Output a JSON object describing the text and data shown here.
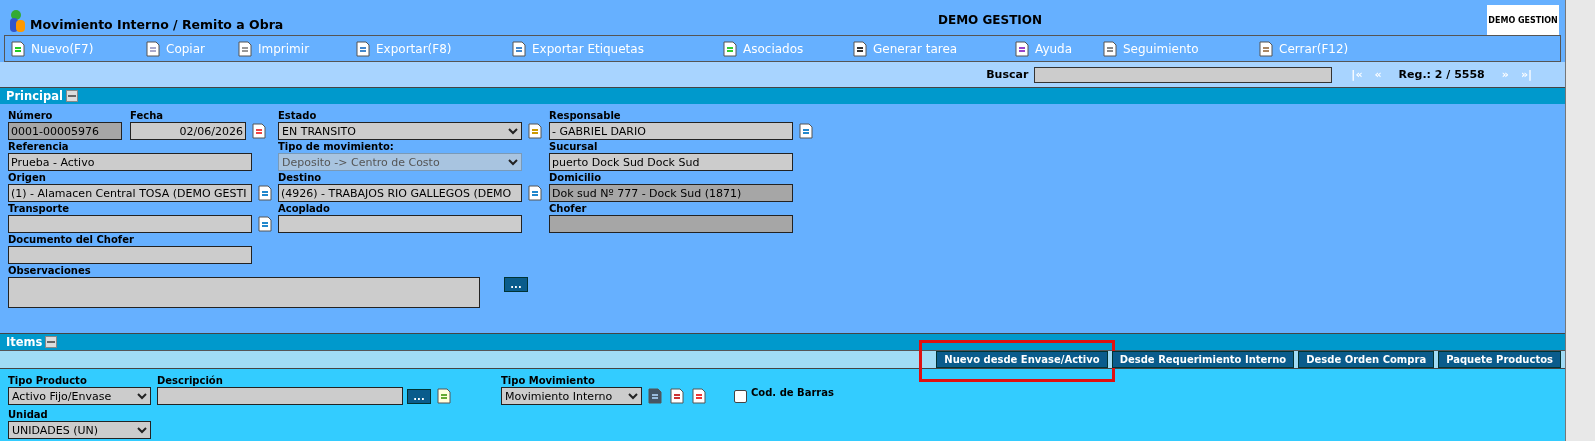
{
  "window": {
    "title": "Movimiento Interno / Remito a Obra",
    "company": "DEMO GESTION",
    "logo_text": "DEMO GESTION"
  },
  "toolbar": [
    {
      "label": "Nuevo(F7)"
    },
    {
      "label": "Copiar"
    },
    {
      "label": "Imprimir"
    },
    {
      "label": "Exportar(F8)"
    },
    {
      "label": "Exportar Etiquetas"
    },
    {
      "label": "Asociados"
    },
    {
      "label": "Generar tarea"
    },
    {
      "label": "Ayuda"
    },
    {
      "label": "Seguimiento"
    },
    {
      "label": "Cerrar(F12)"
    }
  ],
  "search": {
    "label": "Buscar",
    "nav": [
      "|«",
      "«",
      "»",
      "»|"
    ],
    "record": "Reg.: 2 / 5558"
  },
  "principal": {
    "title": "Principal",
    "expanded": true,
    "fields": [
      {
        "label": "Número",
        "value": "0001-00005976",
        "kind": "readonly",
        "disabled": false
      },
      {
        "label": "Fecha",
        "value": "02/06/2026",
        "kind": "date",
        "disabled": false
      },
      {
        "label": "Estado",
        "value": "EN TRANSITO",
        "kind": "select",
        "disabled": false
      },
      {
        "label": "Responsable",
        "value": "- GABRIEL DARIO",
        "kind": "text",
        "disabled": false
      },
      {
        "label": "Referencia",
        "value": "Prueba - Activo",
        "kind": "text",
        "disabled": false
      },
      {
        "label": "Tipo de movimiento:",
        "value": "Deposito -> Centro de Costo",
        "kind": "select",
        "disabled": true
      },
      {
        "label": "Sucursal",
        "value": "puerto Dock Sud Dock Sud",
        "kind": "text",
        "disabled": false
      },
      {
        "label": "Origen",
        "value": "(1) - Alamacen Central TOSA (DEMO GESTI",
        "kind": "text",
        "disabled": false
      },
      {
        "label": "Destino",
        "value": "(4926) - TRABAJOS RIO GALLEGOS (DEMO",
        "kind": "text",
        "disabled": false
      },
      {
        "label": "Domicilio",
        "value": "Dok sud Nº 777 - Dock Sud (1871)",
        "kind": "readonly",
        "disabled": false
      },
      {
        "label": "Transporte",
        "kind": "text",
        "disabled": false
      },
      {
        "label": "Acoplado",
        "kind": "text",
        "disabled": false
      },
      {
        "label": "Chofer",
        "kind": "readonly",
        "disabled": false
      },
      {
        "label": "Documento del Chofer",
        "kind": "text",
        "disabled": false
      },
      {
        "label": "Observaciones",
        "kind": "textarea",
        "disabled": false
      }
    ],
    "more_button": "..."
  },
  "items": {
    "title": "Items",
    "expanded": true,
    "buttons": [
      {
        "label": "Nuevo desde Envase/Activo",
        "highlighted": true
      },
      {
        "label": "Desde Requerimiento Interno",
        "highlighted": false
      },
      {
        "label": "Desde Orden Compra",
        "highlighted": false
      },
      {
        "label": "Paquete Productos",
        "highlighted": false
      }
    ],
    "tipo_producto": {
      "label": "Tipo Producto",
      "value": "Activo Fijo/Envase"
    },
    "descripcion": {
      "label": "Descripción",
      "button": "..."
    },
    "tipo_movimiento": {
      "label": "Tipo Movimiento",
      "value": "Movimiento Interno"
    },
    "barcode": {
      "label": "Cod. de Barras",
      "checked": false
    },
    "unidad": {
      "label": "Unidad",
      "value": "UNIDADES (UN)"
    }
  }
}
